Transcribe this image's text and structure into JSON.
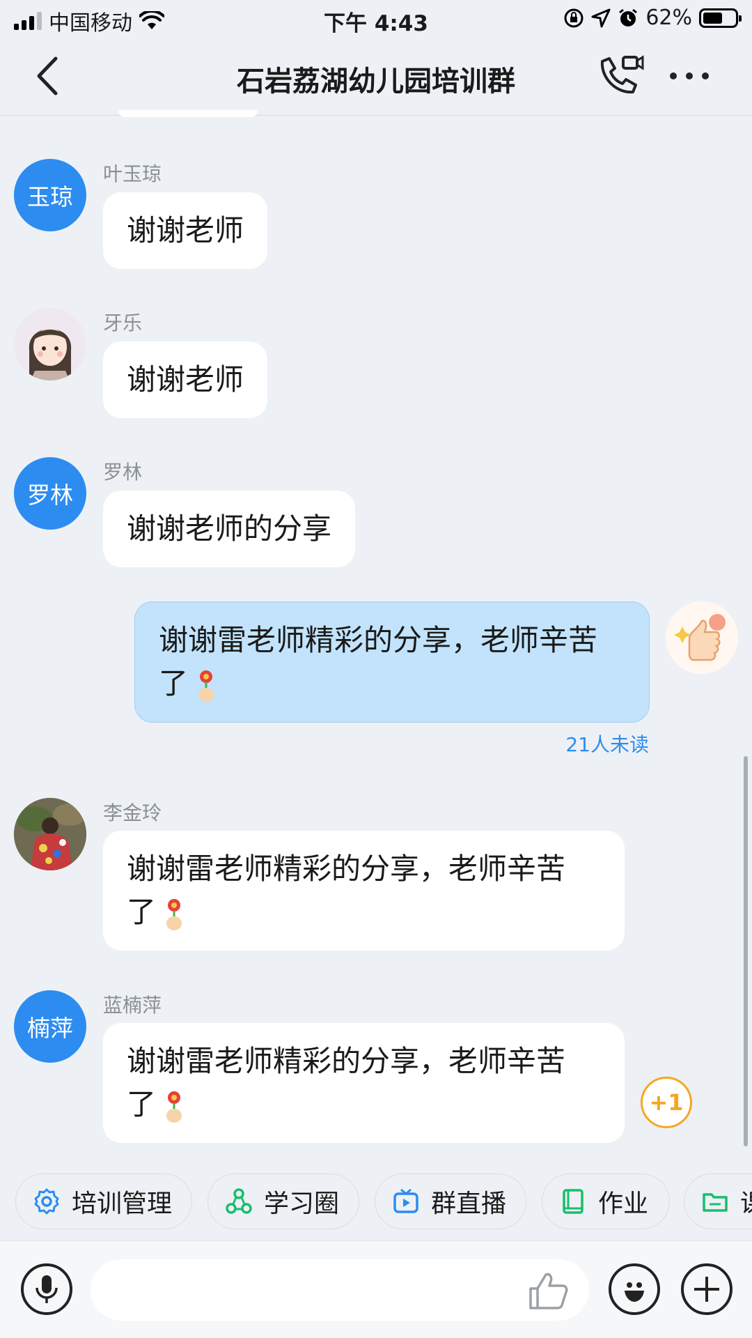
{
  "status_bar": {
    "carrier": "中国移动",
    "time": "下午 4:43",
    "battery": "62%",
    "battery_level": 0.62
  },
  "header": {
    "title": "石岩荔湖幼儿园培训群"
  },
  "messages": [
    {
      "sender": "叶玉琼",
      "avatar_text": "玉琼",
      "text": "谢谢老师"
    },
    {
      "sender": "牙乐",
      "avatar_text": "",
      "text": "谢谢老师"
    },
    {
      "sender": "罗林",
      "avatar_text": "罗林",
      "text": "谢谢老师的分享"
    },
    {
      "sender": "",
      "avatar_text": "",
      "text_line1": "谢谢雷老师精彩的分享，老师辛苦",
      "text_line2": "了",
      "unread": "21人未读"
    },
    {
      "sender": "李金玲",
      "avatar_text": "",
      "text_line1": "谢谢雷老师精彩的分享，老师辛苦",
      "text_line2": "了"
    },
    {
      "sender": "蓝楠萍",
      "avatar_text": "楠萍",
      "text_line1": "谢谢雷老师精彩的分享，老师辛苦",
      "text_line2": "了"
    }
  ],
  "plus_one": "+1",
  "quick_actions": [
    {
      "label": "培训管理",
      "icon": "gear-icon",
      "color": "#2d8cf0"
    },
    {
      "label": "学习圈",
      "icon": "network-icon",
      "color": "#19be6b"
    },
    {
      "label": "群直播",
      "icon": "tv-icon",
      "color": "#2d8cf0"
    },
    {
      "label": "作业",
      "icon": "book-icon",
      "color": "#19be6b"
    },
    {
      "label": "课",
      "icon": "folder-icon",
      "color": "#19be6b"
    }
  ],
  "input": {
    "placeholder": ""
  },
  "colors": {
    "accent": "#2d8cf0",
    "own_bubble": "#c2e3fb",
    "plus_one": "#f5a623"
  }
}
